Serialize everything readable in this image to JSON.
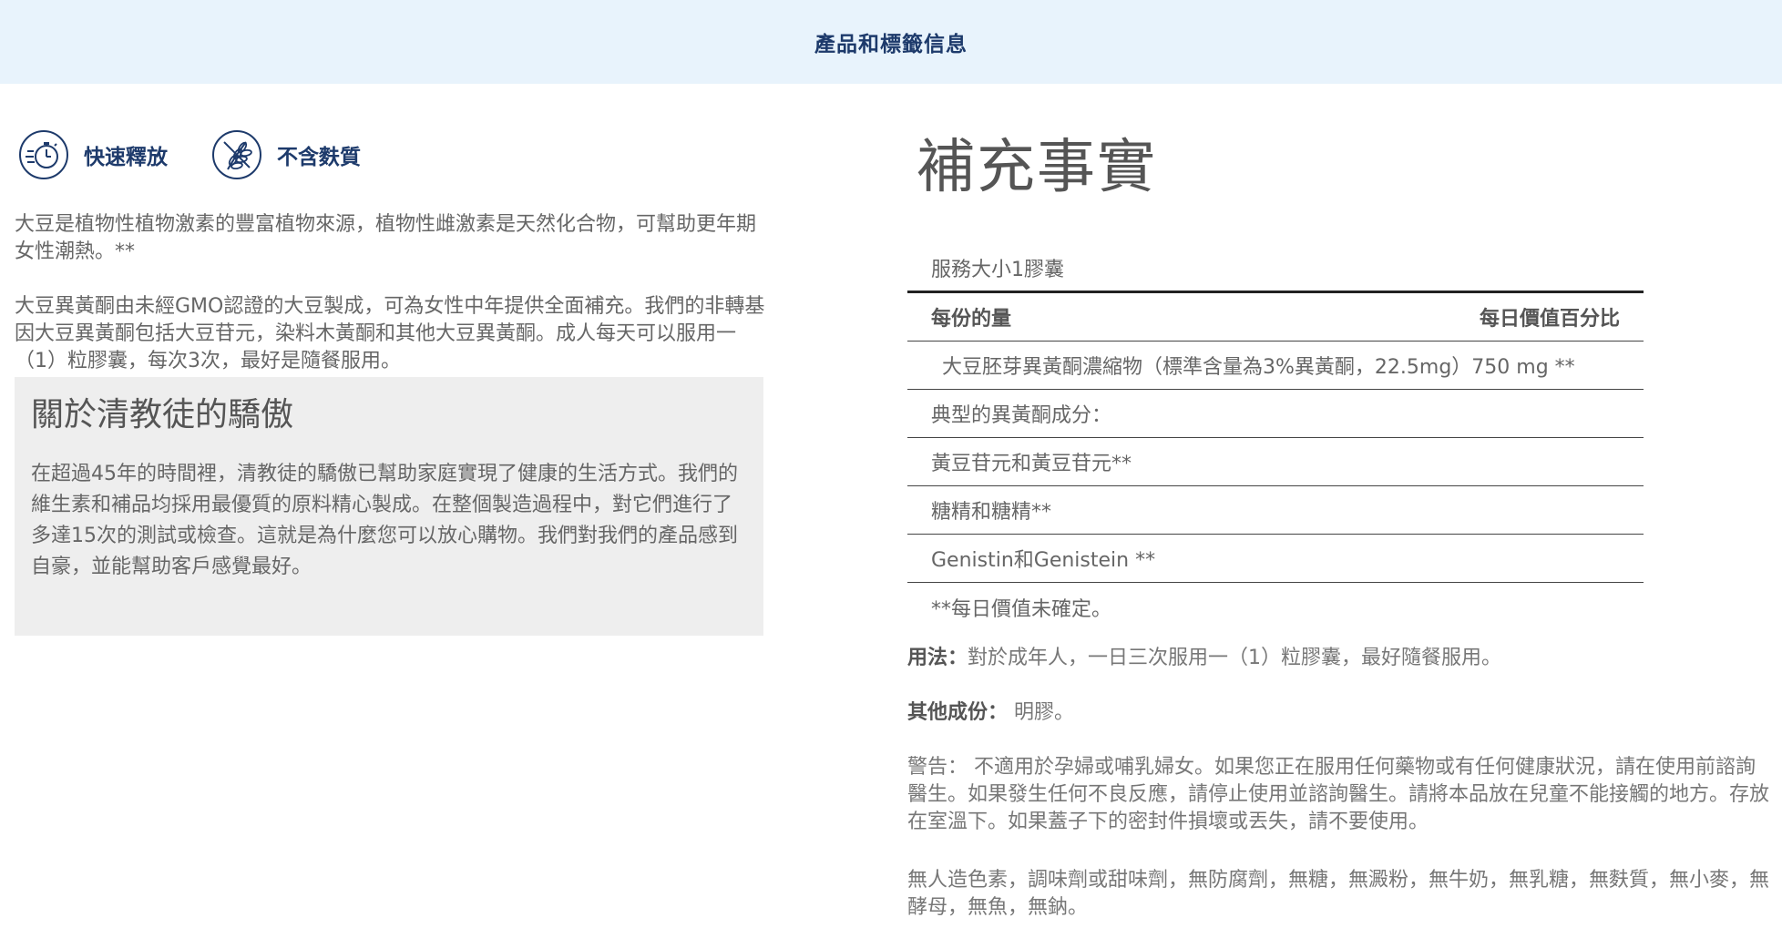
{
  "header": {
    "title": "產品和標籤信息"
  },
  "features": [
    {
      "icon": "fast-release-stopwatch-icon",
      "label": "快速釋放"
    },
    {
      "icon": "gluten-free-wheat-icon",
      "label": "不含麩質"
    }
  ],
  "intro": {
    "paragraph1": "大豆是植物性植物激素的豐富植物來源，植物性雌激素是天然化合物，可幫助更年期女性潮熱。**",
    "paragraph2": "大豆異黃酮由未經GMO認證的大豆製成，可為女性中年提供全面補充。我們的非轉基因大豆異黃酮包括大豆苷元，染料木黃酮和其他大豆異黃酮。成人每天可以服用一（1）粒膠囊，每次3次，最好是隨餐服用。"
  },
  "about": {
    "title": "關於清教徒的驕傲",
    "text": "在超過45年的時間裡，清教徒的驕傲已幫助家庭實現了健康的生活方式。我們的維生素和補品均採用最優質的原料精心製成。在整個製造過程中，對它們進行了多達15次的測試或檢查。這就是為什麼您可以放心購物。我們對我們的產品感到自豪，並能幫助客戶感覺最好。"
  },
  "supplement_facts": {
    "title": "補充事實",
    "serving_size": "服務大小1膠囊",
    "amount_header": "每份的量",
    "dv_header": "每日價值百分比",
    "main_ingredient": "大豆胚芽異黃酮濃縮物（標準含量為3%異黃酮，22.5mg）750 mg **",
    "typical_header": "典型的異黃酮成分：",
    "components": [
      "黃豆苷元和黃豆苷元**",
      "糖精和糖精**",
      "Genistin和Genistein **"
    ],
    "note": "**每日價值未確定。"
  },
  "usage": {
    "label": "用法：",
    "text": "對於成年人，一日三次服用一（1）粒膠囊，最好隨餐服用。"
  },
  "other_ingredients": {
    "label": "其他成份：",
    "text": " 明膠。"
  },
  "warning": {
    "text": "警告： 不適用於孕婦或哺乳婦女。如果您正在服用任何藥物或有任何健康狀況，請在使用前諮詢醫生。如果發生任何不良反應，請停止使用並諮詢醫生。請將本品放在兒童不能接觸的地方。存放在室溫下。如果蓋子下的密封件損壞或丟失，請不要使用。"
  },
  "free_from": {
    "text": "無人造色素，調味劑或甜味劑，無防腐劑，無糖，無澱粉，無牛奶，無乳糖，無麩質，無小麥，無酵母，無魚，無鈉。"
  },
  "colors": {
    "brand_navy": "#1d3a6b",
    "header_bg": "#e8f3fc",
    "box_bg": "#eeeeee"
  }
}
